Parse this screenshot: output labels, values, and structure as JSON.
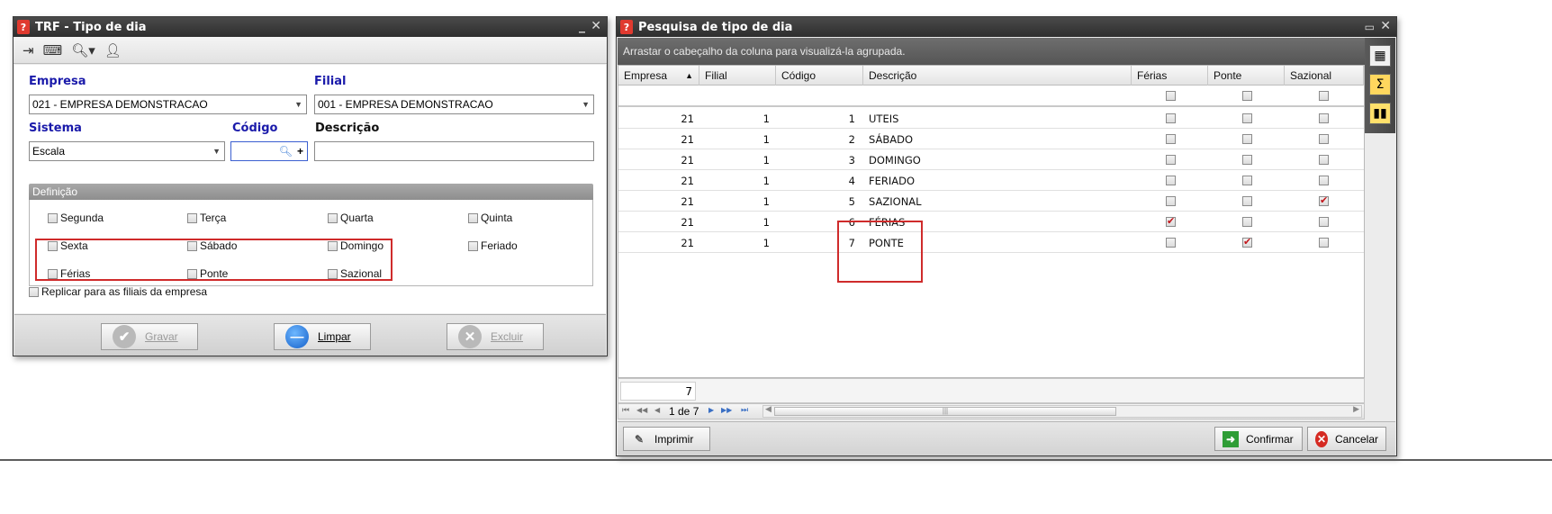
{
  "left_window": {
    "title": "TRF - Tipo de dia",
    "title_controls": "_ X",
    "toolbar_icons": [
      "exit-icon",
      "keyboard-icon",
      "search-dropdown-icon",
      "user-icon"
    ],
    "empresa": {
      "label": "Empresa",
      "value": "021 - EMPRESA DEMONSTRACAO"
    },
    "filial": {
      "label": "Filial",
      "value": "001 - EMPRESA DEMONSTRACAO"
    },
    "sistema": {
      "label": "Sistema",
      "value": "Escala"
    },
    "codigo": {
      "label": "Código",
      "value": ""
    },
    "descricao": {
      "label": "Descrição",
      "value": ""
    },
    "definicao": {
      "header": "Definição",
      "options": [
        {
          "label": "Segunda",
          "checked": false
        },
        {
          "label": "Terça",
          "checked": false
        },
        {
          "label": "Quarta",
          "checked": false
        },
        {
          "label": "Quinta",
          "checked": false
        },
        {
          "label": "Sexta",
          "checked": false
        },
        {
          "label": "Sábado",
          "checked": false
        },
        {
          "label": "Domingo",
          "checked": false
        },
        {
          "label": "Feriado",
          "checked": false
        },
        {
          "label": "Férias",
          "checked": false
        },
        {
          "label": "Ponte",
          "checked": false
        },
        {
          "label": "Sazional",
          "checked": false
        }
      ]
    },
    "replicar_label": "Replicar para as filiais da empresa",
    "buttons": {
      "gravar": "Gravar",
      "limpar": "Limpar",
      "excluir": "Excluir"
    }
  },
  "right_window": {
    "title": "Pesquisa de tipo de dia",
    "title_controls": "▭ X",
    "group_hint": "Arrastar o cabeçalho da coluna para visualizá-la agrupada.",
    "columns": [
      "Empresa",
      "Filial",
      "Código",
      "Descrição",
      "Férias",
      "Ponte",
      "Sazional"
    ],
    "sort_indicator": "▲",
    "rows": [
      {
        "empresa": "21",
        "filial": "1",
        "codigo": "1",
        "descricao": "UTEIS",
        "ferias": false,
        "ponte": false,
        "sazional": false
      },
      {
        "empresa": "21",
        "filial": "1",
        "codigo": "2",
        "descricao": "SÁBADO",
        "ferias": false,
        "ponte": false,
        "sazional": false
      },
      {
        "empresa": "21",
        "filial": "1",
        "codigo": "3",
        "descricao": "DOMINGO",
        "ferias": false,
        "ponte": false,
        "sazional": false
      },
      {
        "empresa": "21",
        "filial": "1",
        "codigo": "4",
        "descricao": "FERIADO",
        "ferias": false,
        "ponte": false,
        "sazional": false
      },
      {
        "empresa": "21",
        "filial": "1",
        "codigo": "5",
        "descricao": "SAZIONAL",
        "ferias": false,
        "ponte": false,
        "sazional": true
      },
      {
        "empresa": "21",
        "filial": "1",
        "codigo": "6",
        "descricao": "FÉRIAS",
        "ferias": true,
        "ponte": false,
        "sazional": false
      },
      {
        "empresa": "21",
        "filial": "1",
        "codigo": "7",
        "descricao": "PONTE",
        "ferias": false,
        "ponte": true,
        "sazional": false
      }
    ],
    "footer_count": "7",
    "navigator": {
      "first": "⏮",
      "prev_page": "◀◀",
      "prev": "◀",
      "page_text": "1 de 7",
      "next": "▶",
      "next_page": "▶▶",
      "last": "⏭"
    },
    "buttons": {
      "imprimir": "Imprimir",
      "confirmar": "Confirmar",
      "cancelar": "Cancelar"
    }
  },
  "colors": {
    "accent_blue": "#1a1aaa",
    "highlight_red": "#cf2b2b",
    "title_bar": "#3a3a3a"
  }
}
